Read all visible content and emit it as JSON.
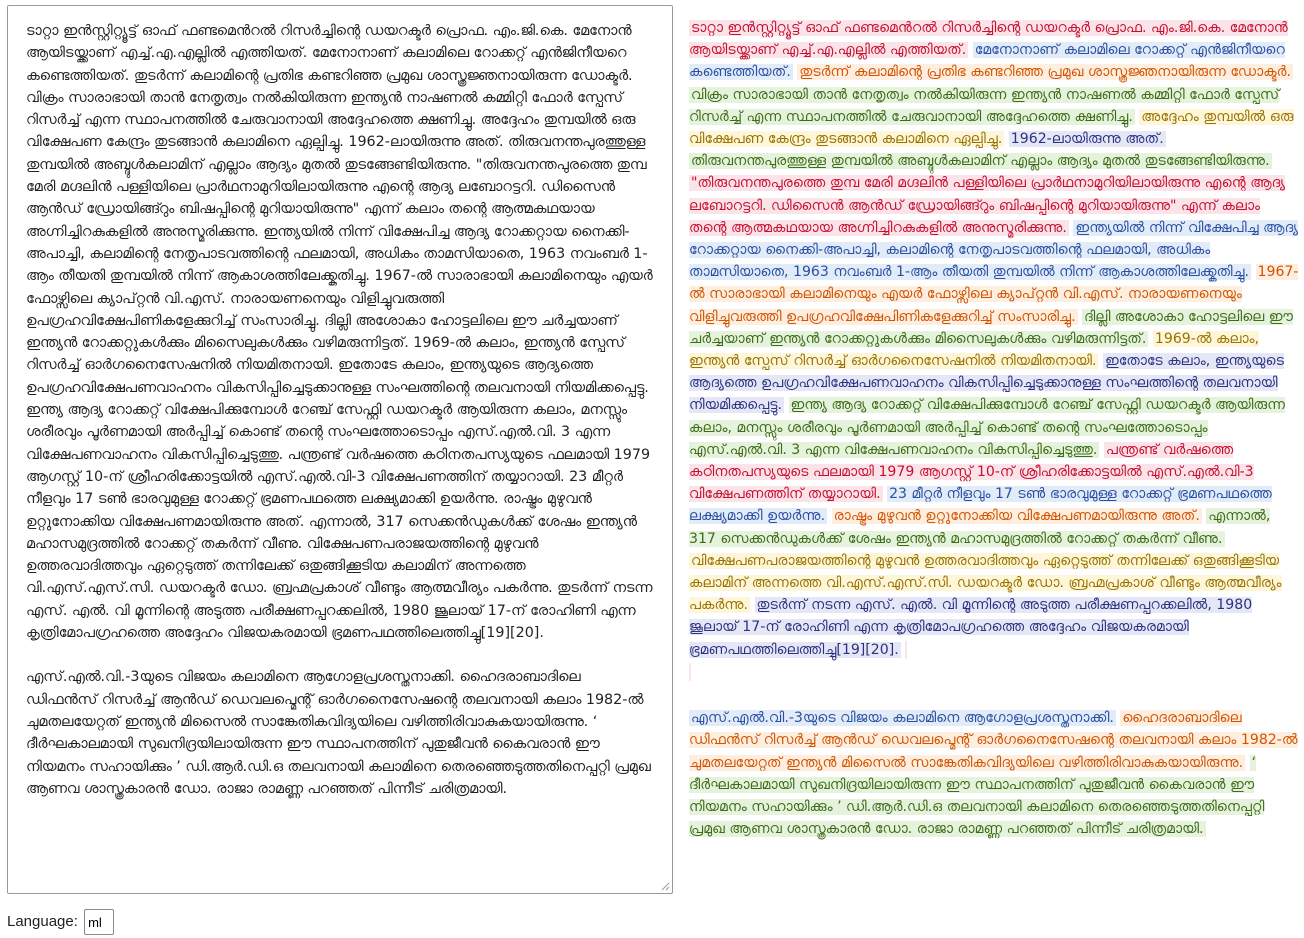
{
  "editor": {
    "paragraphs": [
      "ടാറ്റാ ഇൻസ്റ്റിറ്റ്യൂട്ട് ഓഫ് ഫണ്ടമെൻറൽ റിസർച്ചിന്റെ ഡയറക്ടർ പ്രൊഫ. എം.ജി.കെ. മേനോൻ ആയിടയ്ക്കാണ് എച്ച്.എ.എല്ലിൽ എത്തിയത്. മേനോനാണ് കലാമിലെ റോക്കറ്റ് എൻജിനീയറെ കണ്ടെത്തിയത്. തുടർന്ന് കലാമിന്റെ പ്രതിഭ കണ്ടറിഞ്ഞ പ്രമുഖ ശാസ്ത്രജ്ഞനായിരുന്ന ഡോക്ടർ. വിക്രം സാരാഭായി താൻ നേതൃത്വം നൽകിയിരുന്ന ഇന്ത്യൻ നാഷണൽ കമ്മിറ്റി ഫോർ സ്പേസ് റിസർച്ച് എന്ന സ്ഥാപനത്തിൽ ചേരുവാനായി അദ്ദേഹത്തെ ക്ഷണിച്ചു. അദ്ദേഹം തുമ്പയിൽ ഒരു വിക്ഷേപണ കേന്ദ്രം തുടങ്ങാൻ കലാമിനെ ഏല്പിച്ചു. 1962-ലായിരുന്നു അത്. തിരുവനന്തപുരത്തുള്ള തുമ്പയിൽ അബ്ദുൾകലാമിന് എല്ലാം ആദ്യം മുതൽ തുടങ്ങേണ്ടിയിരുന്നു. \"തിരുവനന്തപുരത്തെ തുമ്പ മേരി മഗ്ദലിൻ പള്ളിയിലെ പ്രാർഥനാമുറിയിലായിരുന്നു എന്റെ ആദ്യ ലബോറട്ടറി. ഡിസൈൻ ആൻഡ് ഡ്രോയിങ്ങ്റും ബിഷപ്പിന്റെ മുറിയായിരുന്നു\" എന്ന് കലാം തന്റെ ആത്മകഥയായ അഗ്നിച്ചിറകുകളിൽ അനുസ്മരിക്കുന്നു. ഇന്ത്യയിൽ നിന്ന് വിക്ഷേപിച്ച ആദ്യ റോക്കറ്റായ നൈക്കി-അപാച്ചി, കലാമിന്റെ നേതൃപാടവത്തിന്റെ ഫലമായി, അധികം താമസിയാതെ, 1963 നവംബർ 1-ആം തീയതി തുമ്പയിൽ നിന്ന് ആകാശത്തിലേക്ക്കുതിച്ചു. 1967-ൽ സാരാഭായി കലാമിനെയും എയർ ഫോഴ്സിലെ ക്യാപ്റ്റൻ വി.എസ്. നാരായണനെയും വിളിച്ചുവരുത്തി ഉപഗ്രഹവിക്ഷേപിണികളേക്കുറിച്ച് സംസാരിച്ചു. ദില്ലി അശോകാ ഹോട്ടലിലെ ഈ ചർച്ചയാണ് ഇന്ത്യൻ റോക്കറ്റുകൾക്കും മിസൈലുകൾക്കും വഴിമരുന്നിട്ടത്. 1969-ൽ കലാം, ഇന്ത്യൻ സ്പേസ് റിസർച്ച് ഓർഗനൈസേഷനിൽ നിയമിതനായി. ഇതോടേ കലാം, ഇന്ത്യയുടെ ആദ്യത്തെ ഉപഗ്രഹവിക്ഷേപണവാഹനം വികസിപ്പിച്ചെടുക്കാനുള്ള സംഘത്തിന്റെ തലവനായി നിയമിക്കപ്പെട്ടു. ഇന്ത്യ ആദ്യ റോക്കറ്റ് വിക്ഷേപിക്കുമ്പോൾ റേഞ്ച് സേഫ്റ്റി ഡയറക്ടർ ആയിരുന്ന കലാം, മനസ്സും ശരീരവും പൂർണമായി അർപ്പിച്ച് കൊണ്ട് തന്റെ സംഘത്തോടൊപ്പം എസ്.എൽ.വി. 3 എന്ന വിക്ഷേപണവാഹനം വികസിപ്പിച്ചെടുത്തു. പന്ത്രണ്ട് വർഷത്തെ കഠിനതപസ്യയുടെ ഫലമായി 1979 ആഗസ്റ്റ് 10-ന് ശ്രീഹരിക്കോട്ടയിൽ എസ്.എൽ.വി-3 വിക്ഷേപണത്തിന് തയ്യാറായി. 23 മീറ്റർ നീളവും 17 ടൺ ഭാരവുമുള്ള റോക്കറ്റ് ഭ്രമണപഥത്തെ ലക്ഷ്യമാക്കി ഉയർന്നു. രാഷ്ട്രം മുഴുവൻ ഉറ്റുനോക്കിയ വിക്ഷേപണമായിരുന്നു അത്. എന്നാൽ, 317 സെക്കൻഡുകൾക്ക് ശേഷം ഇന്ത്യൻ മഹാസമുദ്രത്തിൽ റോക്കറ്റ് തകർന്ന് വീണു. വിക്ഷേപണപരാജയത്തിന്റെ മുഴുവൻ ഉത്തരവാദിത്തവും ഏറ്റെടുത്ത് തന്നിലേക്ക് ഒതുങ്ങിക്കൂടിയ കലാമിന് അന്നത്തെ വി.എസ്.എസ്.സി. ഡയറക്ടർ ഡോ. ബ്രഹ്മപ്രകാശ് വീണ്ടും ആത്മവീര്യം പകർന്നു. തുടർന്ന് നടന്ന എസ്. എൽ. വി മൂന്നിന്റെ അടുത്ത പരീക്ഷണപ്പറക്കലിൽ, 1980 ജൂലായ് 17-ന് രോഹിണി എന്ന കൃത്രിമോപഗ്രഹത്തെ അദ്ദേഹം വിജയകരമായി ഭ്രമണപഥത്തിലെത്തിച്ചു[19][20].",
      "എസ്.എൽ.വി.-3യുടെ വിജയം കലാമിനെ ആഗോളപ്രശസ്തനാക്കി. ഹൈദരാബാദിലെ ഡിഫൻസ് റിസർച്ച് ആൻഡ് ഡെവലപ്മെന്റ് ഓർഗനൈസേഷന്റെ തലവനായി കലാം 1982-ൽ ചുമതലയേറ്റത് ഇന്ത്യൻ മിസൈൽ സാങ്കേതികവിദ്യയിലെ വഴിത്തിരിവാകുകയായിരുന്നു. ‘ ദീർഘകാലമായി സുഖനിദ്രയിലായിരുന്ന ഈ സ്ഥാപനത്തിന് പുതുജീവൻ കൈവരാൻ ഈ നിയമനം സഹായിക്കും ’ ഡി.ആർ.ഡി.ഒ തലവനായി കലാമിനെ തെരഞ്ഞെടുത്തതിനെപ്പറ്റി പ്രമുഖ ആണവ ശാസ്ത്രകാരൻ ഡോ. രാജാ രാമണ്ണ പറഞ്ഞത് പിന്നീട് ചരിത്രമായി."
    ]
  },
  "output": {
    "paragraphs": [
      [
        {
          "text": "ടാറ്റാ ഇൻസ്റ്റിറ്റ്യൂട്ട് ഓഫ് ഫണ്ടമെൻറൽ റിസർച്ചിന്റെ ഡയറക്ടർ പ്രൊഫ. എം.ജി.കെ. മേനോൻ ആയിടയ്ക്കാണ് എച്ച്.എ.എല്ലിൽ എത്തിയത്.",
          "color": "red"
        },
        {
          "text": "മേനോനാണ് കലാമിലെ റോക്കറ്റ് എൻജിനീയറെ കണ്ടെത്തിയത്.",
          "color": "blue"
        },
        {
          "text": "തുടർന്ന് കലാമിന്റെ പ്രതിഭ കണ്ടറിഞ്ഞ പ്രമുഖ ശാസ്ത്രജ്ഞനായിരുന്ന ഡോക്ടർ.",
          "color": "orange"
        },
        {
          "text": "വിക്രം സാരാഭായി താൻ നേതൃത്വം നൽകിയിരുന്ന ഇന്ത്യൻ നാഷണൽ കമ്മിറ്റി ഫോർ സ്പേസ് റിസർച്ച് എന്ന സ്ഥാപനത്തിൽ ചേരുവാനായി അദ്ദേഹത്തെ ക്ഷണിച്ചു.",
          "color": "green"
        },
        {
          "text": "അദ്ദേഹം തുമ്പയിൽ ഒരു വിക്ഷേപണ കേന്ദ്രം തുടങ്ങാൻ കലാമിനെ ഏല്പിച്ചു.",
          "color": "yellow"
        },
        {
          "text": "1962-ലായിരുന്നു അത്.",
          "color": "indigo"
        },
        {
          "text": "തിരുവനന്തപുരത്തുള്ള തുമ്പയിൽ അബ്ദുൾകലാമിന് എല്ലാം ആദ്യം മുതൽ തുടങ്ങേണ്ടിയിരുന്നു.",
          "color": "green"
        },
        {
          "text": "\"തിരുവനന്തപുരത്തെ തുമ്പ മേരി മഗ്ദലിൻ പള്ളിയിലെ പ്രാർഥനാമുറിയിലായിരുന്നു എന്റെ ആദ്യ ലബോറട്ടറി. ഡിസൈൻ ആൻഡ് ഡ്രോയിങ്ങ്റും ബിഷപ്പിന്റെ മുറിയായിരുന്നു\" എന്ന് കലാം തന്റെ ആത്മകഥയായ അഗ്നിച്ചിറകുകളിൽ അനുസ്മരിക്കുന്നു.",
          "color": "red"
        },
        {
          "text": "ഇന്ത്യയിൽ നിന്ന് വിക്ഷേപിച്ച ആദ്യ റോക്കറ്റായ നൈക്കി-അപാച്ചി, കലാമിന്റെ നേതൃപാടവത്തിന്റെ ഫലമായി, അധികം താമസിയാതെ, 1963 നവംബർ 1-ആം തീയതി തുമ്പയിൽ നിന്ന് ആകാശത്തിലേക്ക്കുതിച്ചു.",
          "color": "blue"
        },
        {
          "text": "1967-ൽ സാരാഭായി കലാമിനെയും എയർ ഫോഴ്സിലെ ക്യാപ്റ്റൻ വി.എസ്. നാരായണനെയും വിളിച്ചുവരുത്തി ഉപഗ്രഹവിക്ഷേപിണികളേക്കുറിച്ച് സംസാരിച്ചു.",
          "color": "orange"
        },
        {
          "text": "ദില്ലി അശോകാ ഹോട്ടലിലെ ഈ ചർച്ചയാണ് ഇന്ത്യൻ റോക്കറ്റുകൾക്കും മിസൈലുകൾക്കും വഴിമരുന്നിട്ടത്.",
          "color": "green"
        },
        {
          "text": "1969-ൽ കലാം, ഇന്ത്യൻ സ്പേസ് റിസർച്ച് ഓർഗനൈസേഷനിൽ നിയമിതനായി.",
          "color": "yellow"
        },
        {
          "text": "ഇതോടേ കലാം, ഇന്ത്യയുടെ ആദ്യത്തെ ഉപഗ്രഹവിക്ഷേപണവാഹനം വികസിപ്പിച്ചെടുക്കാനുള്ള സംഘത്തിന്റെ തലവനായി നിയമിക്കപ്പെട്ടു.",
          "color": "indigo"
        },
        {
          "text": "ഇന്ത്യ ആദ്യ റോക്കറ്റ് വിക്ഷേപിക്കുമ്പോൾ റേഞ്ച് സേഫ്റ്റി ഡയറക്ടർ ആയിരുന്ന കലാം, മനസ്സും ശരീരവും പൂർണമായി അർപ്പിച്ച് കൊണ്ട് തന്റെ സംഘത്തോടൊപ്പം എസ്.എൽ.വി. 3 എന്ന വിക്ഷേപണവാഹനം വികസിപ്പിച്ചെടുത്തു.",
          "color": "green"
        },
        {
          "text": "പന്ത്രണ്ട് വർഷത്തെ കഠിനതപസ്യയുടെ ഫലമായി 1979 ആഗസ്റ്റ് 10-ന് ശ്രീഹരിക്കോട്ടയിൽ എസ്.എൽ.വി-3 വിക്ഷേപണത്തിന് തയ്യാറായി.",
          "color": "red"
        },
        {
          "text": "23 മീറ്റർ നീളവും 17 ടൺ ഭാരവുമുള്ള റോക്കറ്റ് ഭ്രമണപഥത്തെ ലക്ഷ്യമാക്കി ഉയർന്നു.",
          "color": "blue"
        },
        {
          "text": "രാഷ്ട്രം മുഴുവൻ ഉറ്റുനോക്കിയ വിക്ഷേപണമായിരുന്നു അത്.",
          "color": "orange"
        },
        {
          "text": "എന്നാൽ, 317 സെക്കൻഡുകൾക്ക് ശേഷം ഇന്ത്യൻ മഹാസമുദ്രത്തിൽ റോക്കറ്റ് തകർന്ന് വീണു.",
          "color": "green"
        },
        {
          "text": "വിക്ഷേപണപരാജയത്തിന്റെ മുഴുവൻ ഉത്തരവാദിത്തവും ഏറ്റെടുത്ത് തന്നിലേക്ക് ഒതുങ്ങിക്കൂടിയ കലാമിന് അന്നത്തെ വി.എസ്.എസ്.സി. ഡയറക്ടർ ഡോ. ബ്രഹ്മപ്രകാശ് വീണ്ടും ആത്മവീര്യം പകർന്നു.",
          "color": "yellow"
        },
        {
          "text": "തുടർന്ന് നടന്ന എസ്. എൽ. വി മൂന്നിന്റെ അടുത്ത പരീക്ഷണപ്പറക്കലിൽ, 1980 ജൂലായ് 17-ന് രോഹിണി എന്ന കൃത്രിമോപഗ്രഹത്തെ അദ്ദേഹം വിജയകരമായി ഭ്രമണപഥത്തിലെത്തിച്ചു[19][20].",
          "color": "indigo"
        }
      ],
      [
        {
          "text": "എസ്.എൽ.വി.-3യുടെ വിജയം കലാമിനെ ആഗോളപ്രശസ്തനാക്കി.",
          "color": "blue"
        },
        {
          "text": "ഹൈദരാബാദിലെ ഡിഫൻസ് റിസർച്ച് ആൻഡ് ഡെവലപ്മെന്റ് ഓർഗനൈസേഷന്റെ തലവനായി കലാം 1982-ൽ ചുമതലയേറ്റത് ഇന്ത്യൻ മിസൈൽ സാങ്കേതികവിദ്യയിലെ വഴിത്തിരിവാകുകയായിരുന്നു.",
          "color": "orange"
        },
        {
          "text": "‘ ദീർഘകാലമായി സുഖനിദ്രയിലായിരുന്ന ഈ സ്ഥാപനത്തിന് പുതുജീവൻ കൈവരാൻ ഈ നിയമനം സഹായിക്കും ’ ഡി.ആർ.ഡി.ഒ തലവനായി കലാമിനെ തെരഞ്ഞെടുത്തതിനെപ്പറ്റി പ്രമുഖ ആണവ ശാസ്ത്രകാരൻ ഡോ. രാജാ രാമണ്ണ പറഞ്ഞത് പിന്നീട് ചരിത്രമായി.",
          "color": "green"
        }
      ]
    ]
  },
  "language": {
    "label": "Language:",
    "value": "ml"
  },
  "colors": {
    "red": "#c8102e",
    "blue": "#2a4fa3",
    "orange": "#d35400",
    "green": "#3e6b19",
    "yellow": "#9a7200",
    "indigo": "#2a3380"
  }
}
